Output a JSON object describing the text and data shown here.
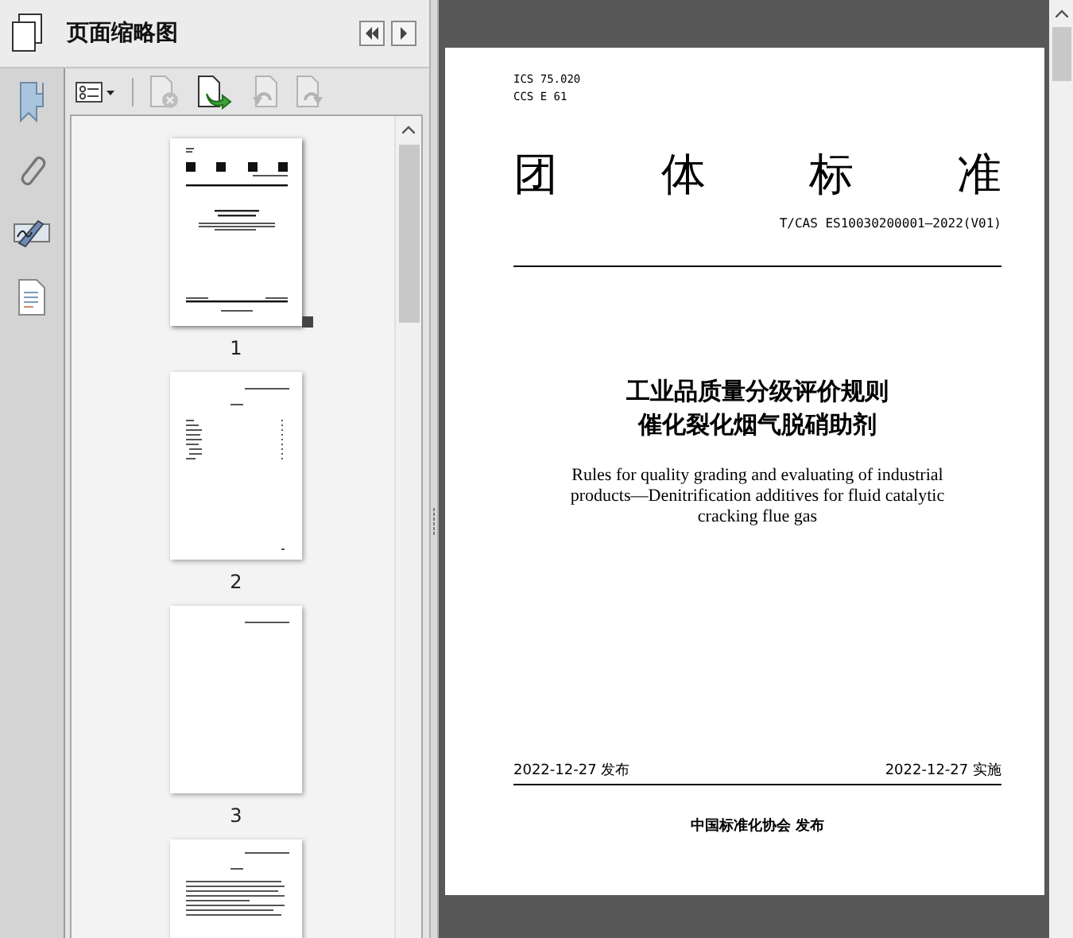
{
  "panel": {
    "title": "页面缩略图"
  },
  "toolbar": [
    {
      "kind": "options",
      "disabled": false
    },
    {
      "kind": "delete",
      "disabled": true
    },
    {
      "kind": "insert",
      "disabled": false
    },
    {
      "kind": "rotate-left",
      "disabled": true
    },
    {
      "kind": "rotate-right",
      "disabled": true
    }
  ],
  "thumbnails": [
    {
      "kind": "cover",
      "label": "1",
      "selected": true
    },
    {
      "kind": "contents",
      "label": "2",
      "selected": false
    },
    {
      "kind": "blank",
      "label": "3",
      "selected": false
    },
    {
      "kind": "text",
      "selected": false
    }
  ],
  "document": {
    "ics": "ICS 75.020",
    "ccs": "CCS E 61",
    "heading": "团 体 标 准",
    "code": "T/CAS ES10030200001—2022(V01)",
    "title_lines": [
      "工业品质量分级评价规则",
      "催化裂化烟气脱硝助剂"
    ],
    "english_title": [
      "Rules for quality grading and evaluating of industrial",
      "products—Denitrification additives for fluid catalytic",
      "cracking flue gas"
    ],
    "issue_date": "2022-12-27 发布",
    "effective_date": "2022-12-27 实施",
    "publisher": "中国标准化协会 发布"
  }
}
